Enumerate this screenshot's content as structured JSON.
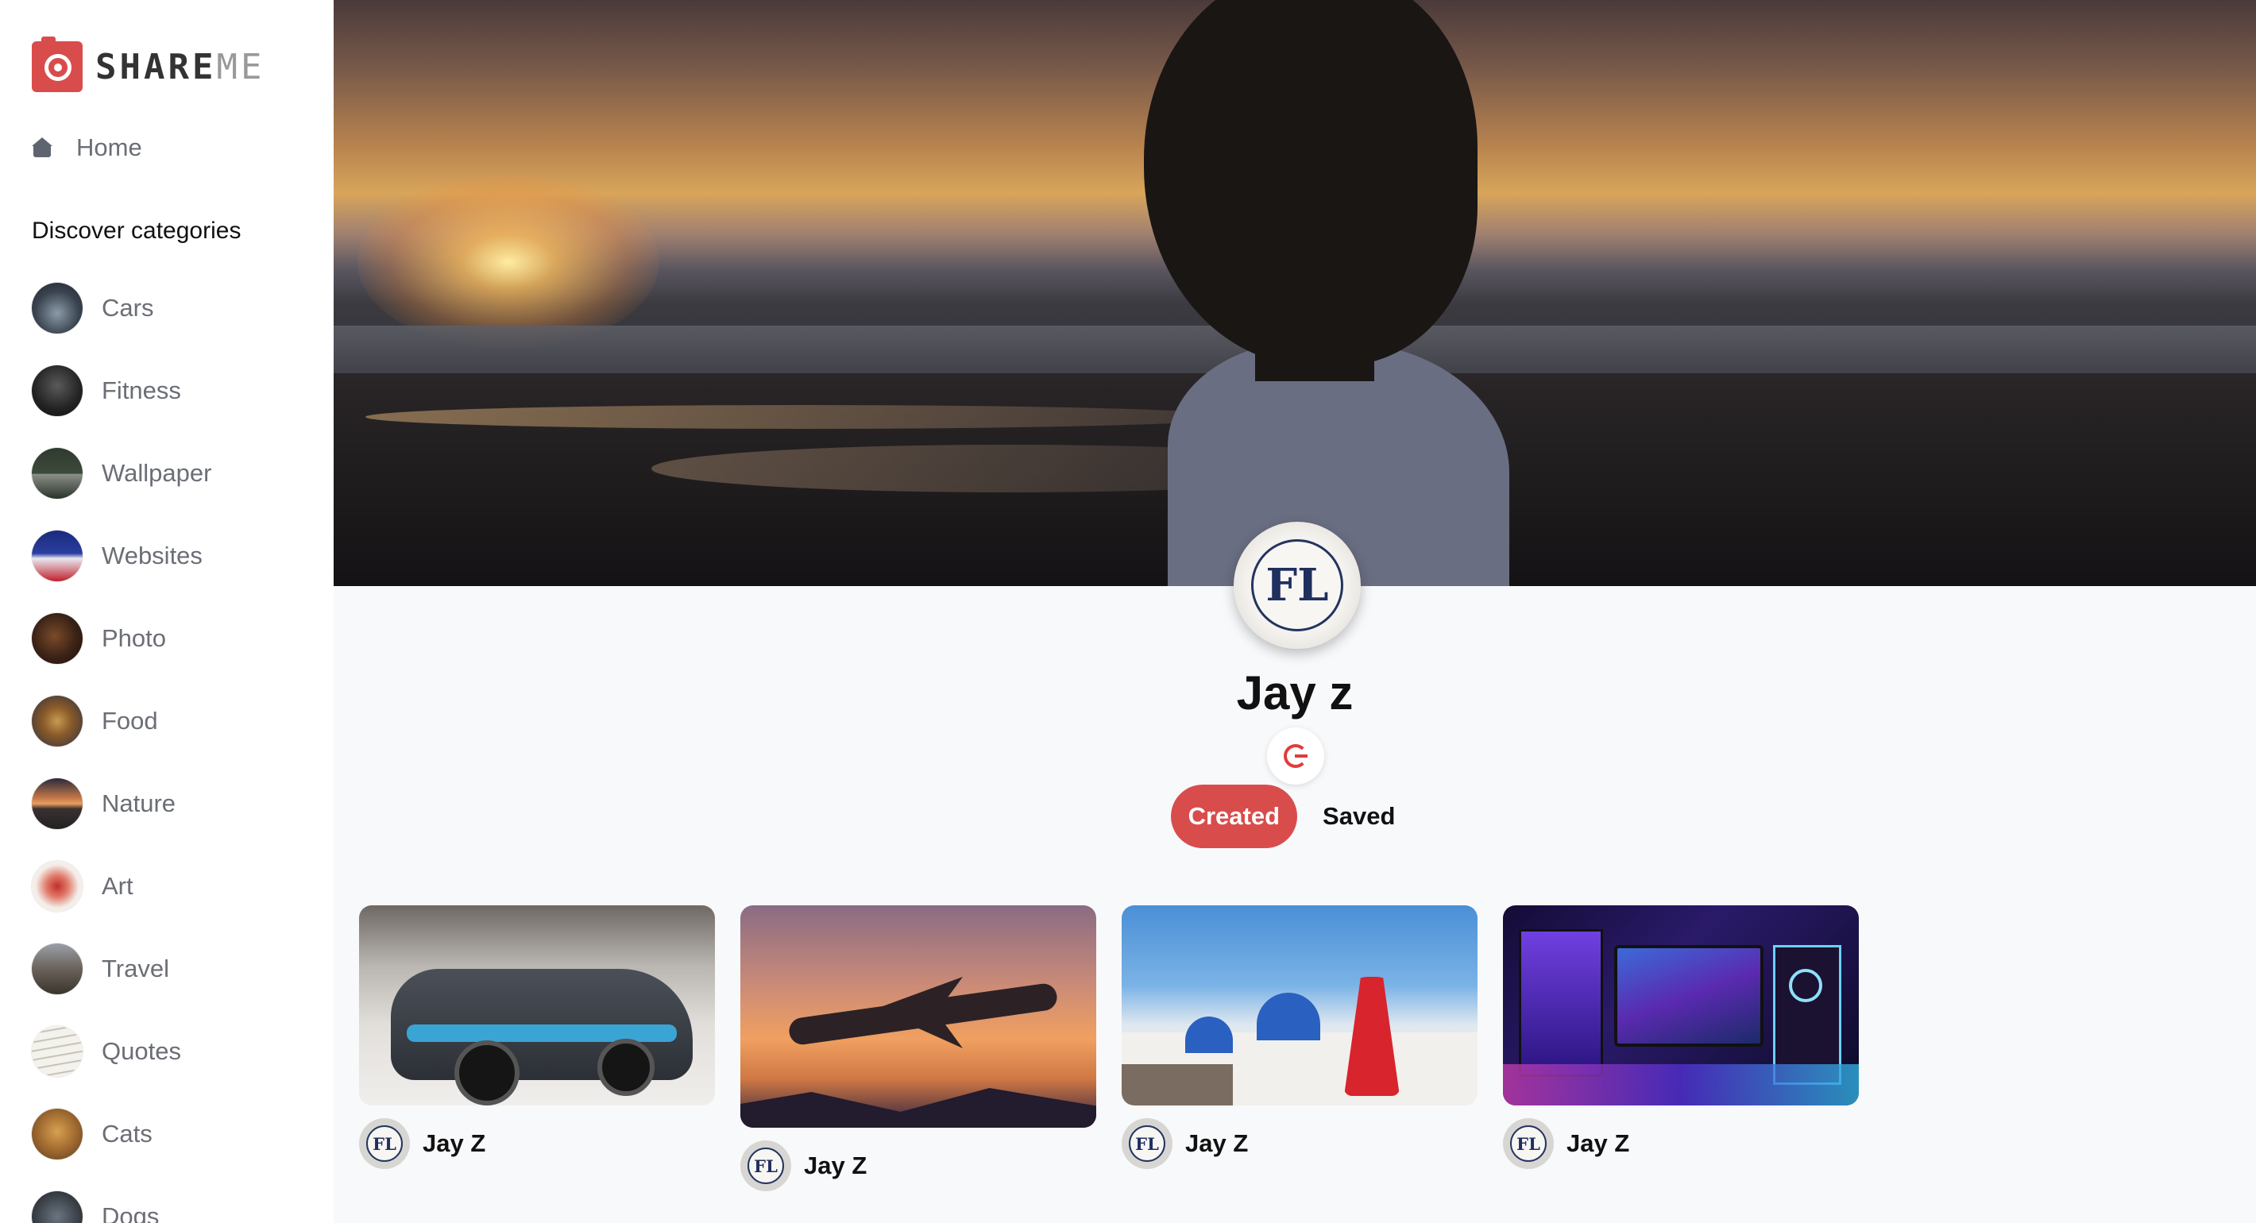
{
  "app": {
    "logo_main": "SHARE",
    "logo_accent": "ME",
    "brand_color": "#d94c4c"
  },
  "sidebar": {
    "home_label": "Home",
    "discover_label": "Discover categories",
    "categories": [
      {
        "label": "Cars"
      },
      {
        "label": "Fitness"
      },
      {
        "label": "Wallpaper"
      },
      {
        "label": "Websites"
      },
      {
        "label": "Photo"
      },
      {
        "label": "Food"
      },
      {
        "label": "Nature"
      },
      {
        "label": "Art"
      },
      {
        "label": "Travel"
      },
      {
        "label": "Quotes"
      },
      {
        "label": "Cats"
      },
      {
        "label": "Dogs"
      }
    ]
  },
  "profile": {
    "name": "Jay z",
    "avatar_initials": "FL",
    "tabs": [
      {
        "label": "Created",
        "active": true
      },
      {
        "label": "Saved",
        "active": false
      }
    ]
  },
  "pins": [
    {
      "author": "Jay Z",
      "avatar_initials": "FL",
      "image": "sports-car"
    },
    {
      "author": "Jay Z",
      "avatar_initials": "FL",
      "image": "airplane-sunset"
    },
    {
      "author": "Jay Z",
      "avatar_initials": "FL",
      "image": "santorini-woman"
    },
    {
      "author": "Jay Z",
      "avatar_initials": "FL",
      "image": "gaming-pc-setup"
    }
  ]
}
